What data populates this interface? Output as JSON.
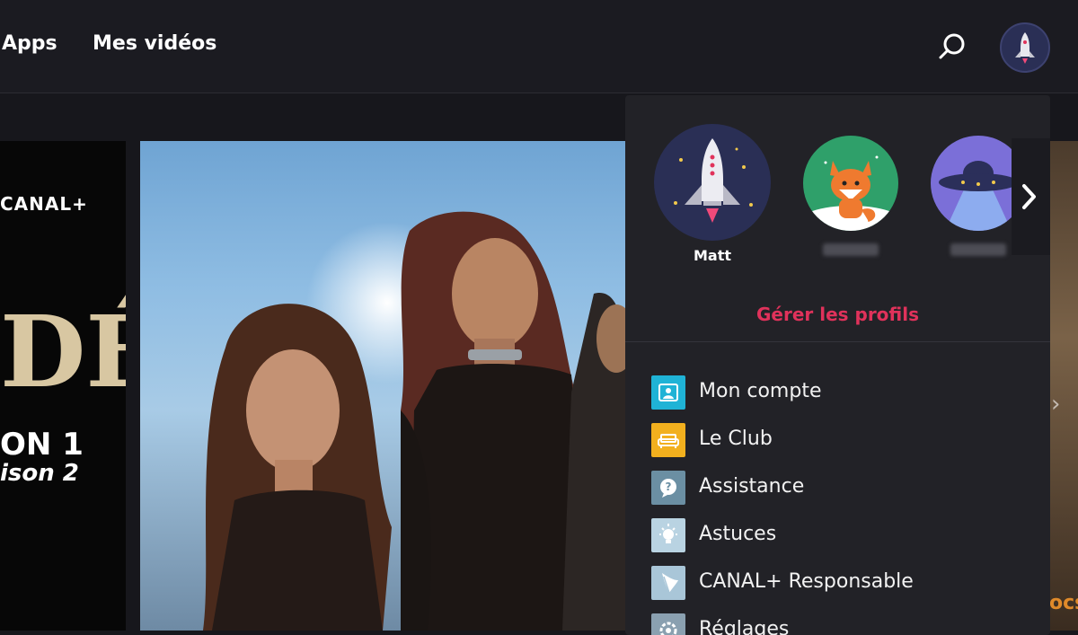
{
  "nav": {
    "apps": "Apps",
    "my_videos": "Mes vidéos"
  },
  "icons": {
    "search": "search-icon",
    "avatar": "rocket-avatar-icon"
  },
  "tiles": {
    "left": {
      "brand": "CANAL+",
      "big": "DÉ",
      "season_line_1": "ON 1",
      "season_line_2": "ison 2"
    },
    "right": {
      "brand": "ocs"
    }
  },
  "profile_menu": {
    "profiles": [
      {
        "name": "Matt",
        "avatar": "rocket",
        "color": "#2a2f55"
      },
      {
        "name": "",
        "avatar": "fox",
        "color": "#2fa06a"
      },
      {
        "name": "",
        "avatar": "ufo",
        "color": "#7b6fd8"
      }
    ],
    "manage_profiles": "Gérer les profils",
    "items": [
      {
        "label": "Mon compte",
        "icon": "account-icon",
        "color": "#1fb3d6"
      },
      {
        "label": "Le Club",
        "icon": "sofa-icon",
        "color": "#f2b01e"
      },
      {
        "label": "Assistance",
        "icon": "help-icon",
        "color": "#6b8fa3"
      },
      {
        "label": "Astuces",
        "icon": "lightbulb-icon",
        "color": "#b9d3e2"
      },
      {
        "label": "CANAL+ Responsable",
        "icon": "leaf-icon",
        "color": "#a9c6d8"
      },
      {
        "label": "Réglages",
        "icon": "gear-icon",
        "color": "#8aa0b0"
      }
    ]
  },
  "accent": "#e0325b"
}
